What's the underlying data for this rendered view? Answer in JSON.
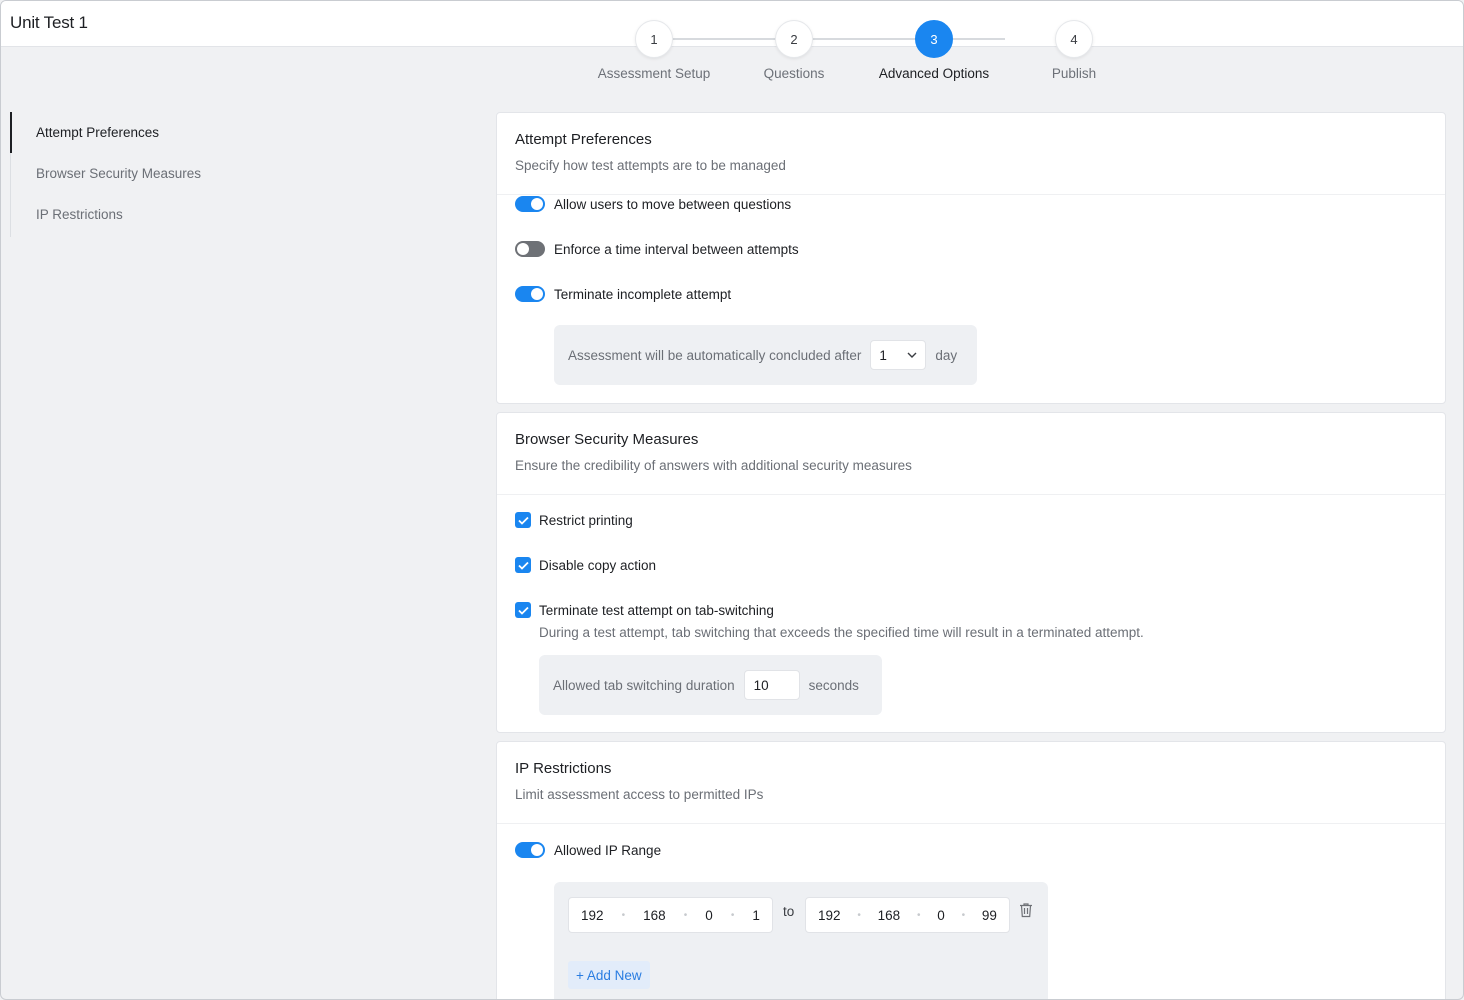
{
  "app": {
    "title": "Unit Test 1"
  },
  "stepper": {
    "steps": [
      {
        "number": "1",
        "label": "Assessment Setup"
      },
      {
        "number": "2",
        "label": "Questions"
      },
      {
        "number": "3",
        "label": "Advanced Options"
      },
      {
        "number": "4",
        "label": "Publish"
      }
    ],
    "active_step": 3
  },
  "sidenav": {
    "items": [
      {
        "label": "Attempt Preferences",
        "active": true
      },
      {
        "label": "Browser Security Measures",
        "active": false
      },
      {
        "label": "IP Restrictions",
        "active": false
      }
    ]
  },
  "attempt": {
    "title": "Attempt Preferences",
    "desc": "Specify how test attempts are to be managed",
    "options": [
      {
        "label": "Allow users to move between questions",
        "on": true
      },
      {
        "label": "Enforce a time interval between attempts",
        "on": false
      },
      {
        "label": "Terminate incomplete attempt",
        "on": true
      }
    ],
    "conclude_label": "Assessment will be automatically concluded after",
    "conclude_value": "1",
    "conclude_unit": "day"
  },
  "browser": {
    "title": "Browser Security Measures",
    "desc": "Ensure the credibility of answers with additional security measures",
    "options": [
      {
        "label": "Restrict printing",
        "checked": true
      },
      {
        "label": "Disable copy action",
        "checked": true
      },
      {
        "label": "Terminate test attempt on tab-switching",
        "checked": true
      }
    ],
    "tab_note": "During a test attempt, tab switching that exceeds the specified time will result in a terminated attempt.",
    "duration_label": "Allowed tab switching duration",
    "duration_value": "10",
    "duration_unit": "seconds"
  },
  "ip": {
    "title": "IP Restrictions",
    "desc": "Limit assessment access to permitted IPs",
    "range_label": "Allowed IP Range",
    "range_on": true,
    "from": [
      "192",
      "168",
      "0",
      "1"
    ],
    "to_word": "to",
    "to": [
      "192",
      "168",
      "0",
      "99"
    ],
    "add_new": "+ Add New"
  },
  "colors": {
    "accent": "#1a86f0",
    "toggle_off": "#6e7176",
    "text": "#1d1f23",
    "muted": "#6b6f76"
  }
}
